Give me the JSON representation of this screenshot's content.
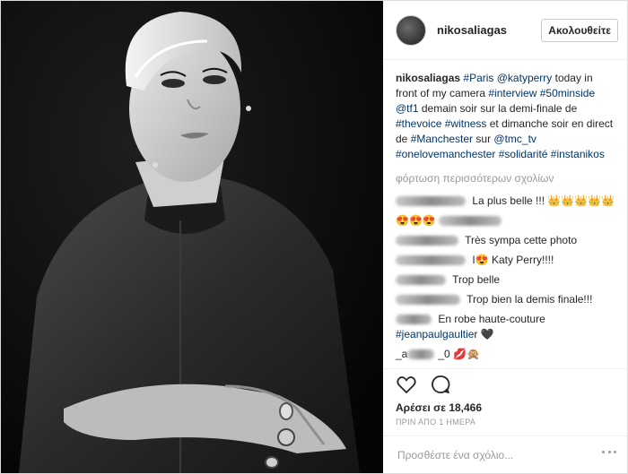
{
  "post": {
    "username": "nikosaliagas",
    "follow_label": "Ακολουθείτε",
    "caption": {
      "author": "nikosaliagas",
      "t1": "#Paris",
      "t2": "@katyperry",
      "t3": " today in front of my camera ",
      "t4": "#interview",
      "t5": " ",
      "t6": "#50minside",
      "t7": " ",
      "t8": "@tf1",
      "t9": " demain soir sur la demi-finale de ",
      "t10": "#thevoice",
      "t11": " ",
      "t12": "#witness",
      "t13": " et dimanche soir en direct de ",
      "t14": "#Manchester",
      "t15": " sur ",
      "t16": "@tmc_tv",
      "t17": " ",
      "t18": "#onelovemanchester",
      "t19": " ",
      "t20": "#solidarité",
      "t21": " ",
      "t22": "#instanikos"
    },
    "load_more": "φόρτωση περισσότερων σχολίων",
    "comments": [
      {
        "text": "La plus belle !!! 👑👑👑👑👑"
      },
      {
        "text": "😍😍😍"
      },
      {
        "text": "Très sympa cette photo"
      },
      {
        "text": "I😍 Katy Perry!!!!"
      },
      {
        "text": "Trop belle"
      },
      {
        "text": "Trop bien la demis finale!!!"
      },
      {
        "text": "En robe haute-couture",
        "tag": "#jeanpaulgaultier",
        "after": " 🖤"
      },
      {
        "prefix": "_a",
        "mid": "_0",
        "text": " 💋🙊"
      }
    ],
    "likes": "Αρέσει σε 18,466",
    "time": "ΠΡΙΝ ΑΠΟ 1 ΗΜΕΡΑ",
    "add_comment_placeholder": "Προσθέστε ένα σχόλιο..."
  },
  "icons": {
    "like": "heart-icon",
    "comment": "comment-bubble-icon",
    "more": "more-options-icon"
  },
  "colors": {
    "hashtag": "#003569",
    "muted": "#999999"
  }
}
